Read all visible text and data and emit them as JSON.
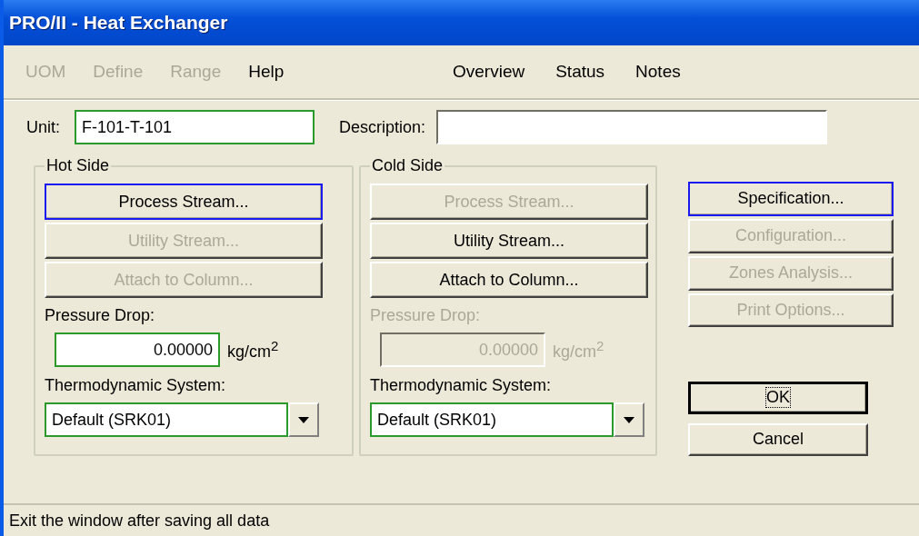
{
  "window": {
    "title": "PRO/II - Heat Exchanger"
  },
  "menu_left": [
    {
      "label": "UOM",
      "disabled": true
    },
    {
      "label": "Define",
      "disabled": true
    },
    {
      "label": "Range",
      "disabled": true
    },
    {
      "label": "Help",
      "disabled": false
    }
  ],
  "menu_right": [
    {
      "label": "Overview",
      "disabled": false
    },
    {
      "label": "Status",
      "disabled": false
    },
    {
      "label": "Notes",
      "disabled": false
    }
  ],
  "unit": {
    "label": "Unit:",
    "value": "F-101-T-101"
  },
  "description": {
    "label": "Description:"
  },
  "sides": [
    {
      "title": "Hot Side",
      "buttons": [
        {
          "label": "Process Stream...",
          "disabled": false,
          "focused": true
        },
        {
          "label": "Utility Stream...",
          "disabled": true,
          "focused": false
        },
        {
          "label": "Attach to Column...",
          "disabled": true,
          "focused": false
        }
      ],
      "pressure_drop": {
        "label": "Pressure Drop:",
        "value": "0.00000",
        "unit": "kg/cm$^{2}$",
        "disabled": false
      },
      "thermo": {
        "label": "Thermodynamic System:",
        "value": "Default (SRK01)"
      }
    },
    {
      "title": "Cold Side",
      "buttons": [
        {
          "label": "Process Stream...",
          "disabled": true,
          "focused": false
        },
        {
          "label": "Utility Stream...",
          "disabled": false,
          "focused": false
        },
        {
          "label": "Attach to Column...",
          "disabled": false,
          "focused": false
        }
      ],
      "pressure_drop": {
        "label": "Pressure Drop:",
        "value": "0.00000",
        "unit": "kg/cm$^{2}$",
        "disabled": true
      },
      "thermo": {
        "label": "Thermodynamic System:",
        "value": "Default (SRK01)"
      }
    }
  ],
  "actions": [
    {
      "label": "Specification...",
      "disabled": false,
      "focused": true
    },
    {
      "label": "Configuration...",
      "disabled": true,
      "focused": false
    },
    {
      "label": "Zones Analysis...",
      "disabled": true,
      "focused": false
    },
    {
      "label": "Print Options...",
      "disabled": true,
      "focused": false
    }
  ],
  "dialog_buttons": [
    {
      "label": "OK",
      "default": true
    },
    {
      "label": "Cancel",
      "default": false
    }
  ],
  "status_bar": "Exit the window after saving all data"
}
